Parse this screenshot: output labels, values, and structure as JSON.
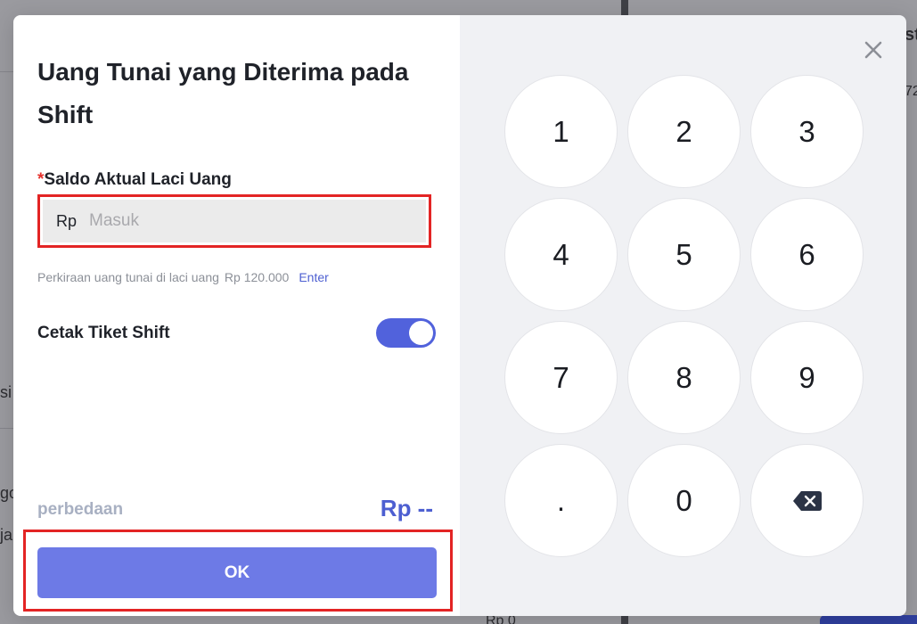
{
  "background": {
    "fragments": [
      "st",
      "72",
      "si",
      "go",
      "ja",
      "Rp 0"
    ]
  },
  "modal": {
    "title": "Uang Tunai yang Diterima pada Shift",
    "field": {
      "required_mark": "*",
      "label": "Saldo Aktual Laci Uang",
      "prefix": "Rp",
      "placeholder": "Masuk",
      "value": ""
    },
    "hint": {
      "text": "Perkiraan uang tunai di laci uang",
      "amount": "Rp 120.000",
      "link": "Enter"
    },
    "toggle": {
      "label": "Cetak Tiket Shift",
      "on": true
    },
    "difference": {
      "label": "perbedaan",
      "value": "Rp --"
    },
    "ok_label": "OK"
  },
  "keypad": {
    "keys": [
      "1",
      "2",
      "3",
      "4",
      "5",
      "6",
      "7",
      "8",
      "9",
      ".",
      "0"
    ],
    "backspace_icon": "backspace-icon",
    "close_icon": "close-icon"
  },
  "colors": {
    "accent": "#5162dc",
    "ok_button": "#6d7ae6",
    "highlight": "#e32424",
    "required": "#e5322d"
  }
}
